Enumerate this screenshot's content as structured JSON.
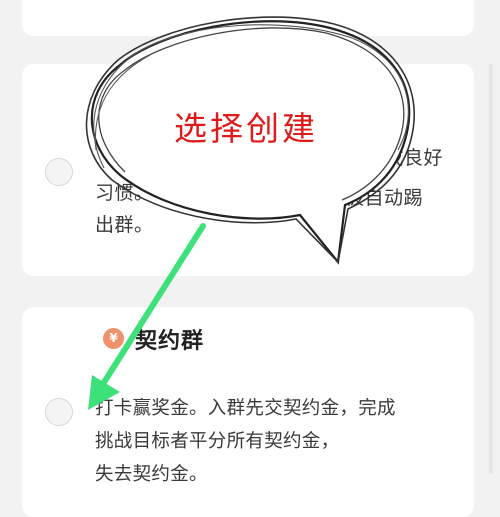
{
  "cards": {
    "middle": {
      "line1_right": "养成良好",
      "line1_left": "习惯。",
      "line2_right": "被自动踢",
      "line3": "出群。"
    },
    "contract_group": {
      "badge_symbol": "¥",
      "title": "契约群",
      "description_lines": [
        "打卡赢奖金。入群先交契约金，完成",
        "挑战目标者平分所有契约金，",
        "失去契约金。"
      ]
    }
  },
  "annotation": {
    "callout_text": "选择创建",
    "callout_text_color": "#e01a1a",
    "arrow_color": "#3ee07a"
  }
}
